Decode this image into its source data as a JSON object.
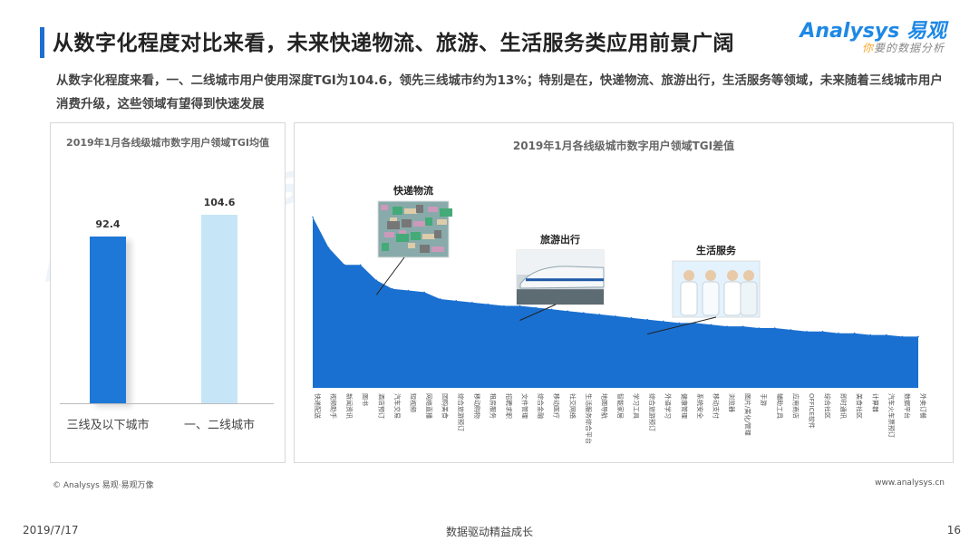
{
  "header": {
    "title": "从数字化程度对比来看，未来快递物流、旅游、生活服务类应用前景广阔",
    "subtitle": "从数字化程度来看，一、二线城市用户使用深度TGI为104.6，领先三线城市约为13%；特别是在，快递物流、旅游出行，生活服务等领域，未来随着三线城市用户消费升级，这些领域有望得到快速发展"
  },
  "logo": {
    "brand": "Analysys 易观",
    "tagline_a": "你",
    "tagline_b": "要的数据分析"
  },
  "colors": {
    "accent": "#1e6fcf",
    "bar_dark": "#1e78d8",
    "bar_light": "#c6e6f8",
    "area": "#1a70d0"
  },
  "chart_data": [
    {
      "type": "bar",
      "title": "2019年1月各线级城市数字用户领域TGI均值",
      "categories": [
        "三线及以下城市",
        "一、二线城市"
      ],
      "values": [
        92.4,
        104.6
      ],
      "value_labels": [
        "92.4",
        "104.6"
      ],
      "ylim": [
        0,
        120
      ]
    },
    {
      "type": "area",
      "title": "2019年1月各线级城市数字用户领域TGI差值",
      "categories": [
        "快递配送",
        "视频助手",
        "新闻资讯",
        "图书",
        "酒店预订",
        "汽车交易",
        "短视频",
        "网络直播",
        "团购美食",
        "综合旅游预订",
        "移动购物",
        "租房服务",
        "招聘求职",
        "文件管理",
        "综合金融",
        "移动医疗",
        "社交网络",
        "生活服务综合平台",
        "地图导航",
        "智能家居",
        "学习工具",
        "综合旅游预订",
        "外语学习",
        "健康管理",
        "系统安全",
        "移动支付",
        "浏览器",
        "图片/美化/管理",
        "手游",
        "辅助工具",
        "应用商店",
        "OFFICE软件",
        "综合社区",
        "即时通讯",
        "美食社区",
        "计算器",
        "汽车火车票预订",
        "数据平台",
        "外卖订餐"
      ],
      "values": [
        100,
        82,
        72,
        72,
        63,
        58,
        57,
        56,
        52,
        51,
        50,
        49,
        48,
        48,
        47,
        46,
        45,
        44,
        43,
        42,
        41,
        40,
        39,
        38,
        38,
        37,
        36,
        36,
        35,
        35,
        34,
        33,
        33,
        32,
        32,
        31,
        31,
        30,
        30
      ],
      "ylim": [
        0,
        110
      ],
      "annotations": [
        {
          "label": "快递物流",
          "index": 4
        },
        {
          "label": "旅游出行",
          "index": 13
        },
        {
          "label": "生活服务",
          "index": 21
        }
      ]
    }
  ],
  "footer": {
    "copyright": "© Analysys 易观·易观万像",
    "website": "www.analysys.cn",
    "date": "2019/7/17",
    "slogan": "数据驱动精益成长",
    "page": "16"
  }
}
